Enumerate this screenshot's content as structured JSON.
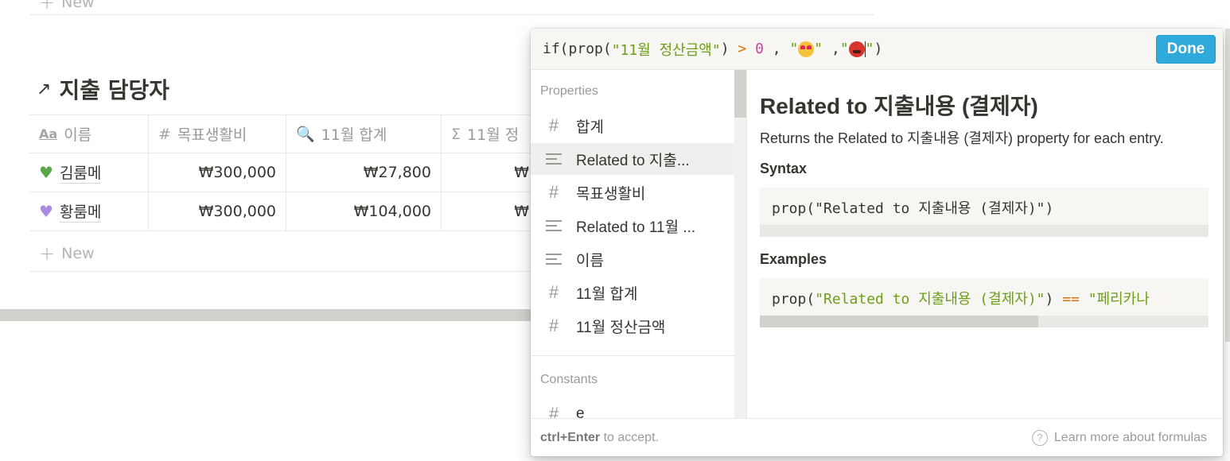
{
  "background": {
    "top_new_label": "New",
    "database_title": "지출 담당자",
    "columns": [
      {
        "icon": "Aa",
        "label": "이름"
      },
      {
        "icon": "#",
        "label": "목표생활비"
      },
      {
        "icon": "🔍",
        "label": "11월 합계"
      },
      {
        "icon": "Σ",
        "label": "11월 정"
      }
    ],
    "rows": [
      {
        "icon": "💚",
        "name": "김룸메",
        "target": "₩300,000",
        "total": "₩27,800",
        "partial": "₩"
      },
      {
        "icon": "💜",
        "name": "황룸메",
        "target": "₩300,000",
        "total": "₩104,000",
        "partial": "₩"
      }
    ],
    "bottom_new_label": "New"
  },
  "formula": {
    "tokens": {
      "fn_if": "if(",
      "fn_prop": "prop(",
      "str_prop": "\"11월 정산금액\"",
      "close1": ")",
      "op_gt": ">",
      "num_zero": "0",
      "comma1": ",",
      "quote_open1": "\"",
      "quote_close1": "\"",
      "comma2": ",",
      "quote_open2": "\"",
      "quote_close2": "\"",
      "close2": ")"
    },
    "done_label": "Done"
  },
  "sidebar": {
    "properties_label": "Properties",
    "items": [
      {
        "type": "number",
        "label": "합계"
      },
      {
        "type": "text",
        "label": "Related to 지출..."
      },
      {
        "type": "number",
        "label": "목표생활비"
      },
      {
        "type": "text",
        "label": "Related to 11월 ..."
      },
      {
        "type": "text",
        "label": "이름"
      },
      {
        "type": "number",
        "label": "11월 합계"
      },
      {
        "type": "number",
        "label": "11월 정산금액"
      }
    ],
    "constants_label": "Constants",
    "constants": [
      {
        "type": "number",
        "label": "e"
      }
    ]
  },
  "detail": {
    "title": "Related to 지출내용 (결제자)",
    "description": "Returns the Related to 지출내용 (결제자) property for each entry.",
    "syntax_label": "Syntax",
    "syntax_code": "prop(\"Related to 지출내용 (결제자)\")",
    "examples_label": "Examples",
    "example": {
      "prefix": "prop(",
      "string": "\"Related to 지출내용 (결제자)\"",
      "close": ")",
      "op": "==",
      "compare": "\"페리카나"
    },
    "example_scroll_fraction": 0.62
  },
  "footer": {
    "shortcut": "ctrl+Enter",
    "hint_rest": " to accept.",
    "learn_more": "Learn more about formulas"
  },
  "colors": {
    "accent": "#2eaadc",
    "string": "#6d9e17",
    "operator": "#d9730d",
    "number": "#c4469b"
  }
}
